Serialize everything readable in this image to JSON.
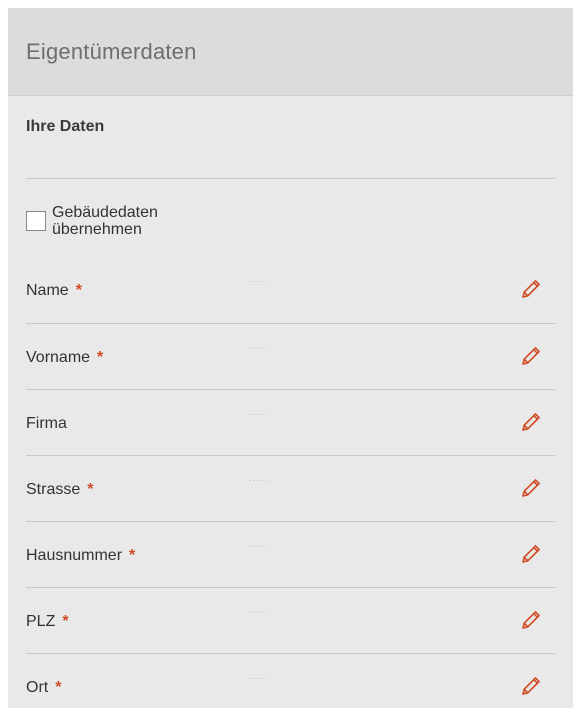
{
  "header": {
    "title": "Eigentümerdaten"
  },
  "section": {
    "title": "Ihre Daten"
  },
  "checkbox": {
    "label": "Gebäudedaten übernehmen",
    "checked": false
  },
  "fields": [
    {
      "label": "Name",
      "required": "*",
      "value": "·····"
    },
    {
      "label": "Vorname",
      "required": "*",
      "value": "·····"
    },
    {
      "label": "Firma",
      "required": "",
      "value": "·····"
    },
    {
      "label": "Strasse",
      "required": "*",
      "value": "·····"
    },
    {
      "label": "Hausnummer",
      "required": "*",
      "value": "·····"
    },
    {
      "label": "PLZ",
      "required": "*",
      "value": "·····"
    },
    {
      "label": "Ort",
      "required": "*",
      "value": "·····"
    }
  ],
  "colors": {
    "accent": "#d04a23",
    "panel_bg": "#e9e9e9",
    "header_bg": "#dcdcdc"
  },
  "icons": {
    "edit": "pencil-icon"
  }
}
